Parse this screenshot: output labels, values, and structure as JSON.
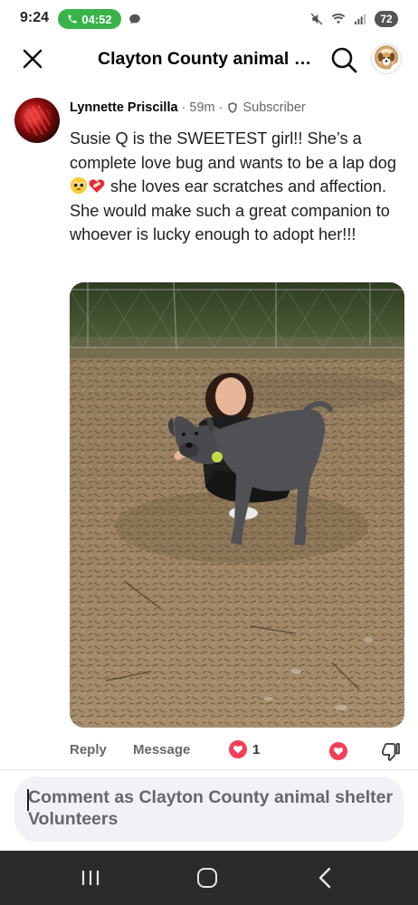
{
  "status_bar": {
    "time": "9:24",
    "call_timer": "04:52",
    "battery": "72"
  },
  "header": {
    "title": "Clayton County animal shelter Volunteers",
    "close_icon": "close-icon",
    "search_icon": "search-icon"
  },
  "comment": {
    "author": "Lynnette Priscilla",
    "time": "59m",
    "badge": "Subscriber",
    "text_before_emoji": "Susie Q is the SWEETEST girl!! She’s a complete love bug and wants to be a lap dog ",
    "text_after_emoji": " she loves ear scratches and affection. She would make such a great companion to whoever is lucky enough to adopt her!!!",
    "emojis": [
      "pleading-face-emoji",
      "mending-heart-emoji"
    ]
  },
  "actions": {
    "reply": "Reply",
    "message": "Message",
    "reaction_count": "1"
  },
  "composer": {
    "placeholder": "Comment as Clayton County animal shelter Volunteers"
  },
  "colors": {
    "accent_love": "#f33e58",
    "call_green": "#37b34a",
    "muted_text": "#65676b",
    "nav_bg": "#2b2b2b"
  }
}
